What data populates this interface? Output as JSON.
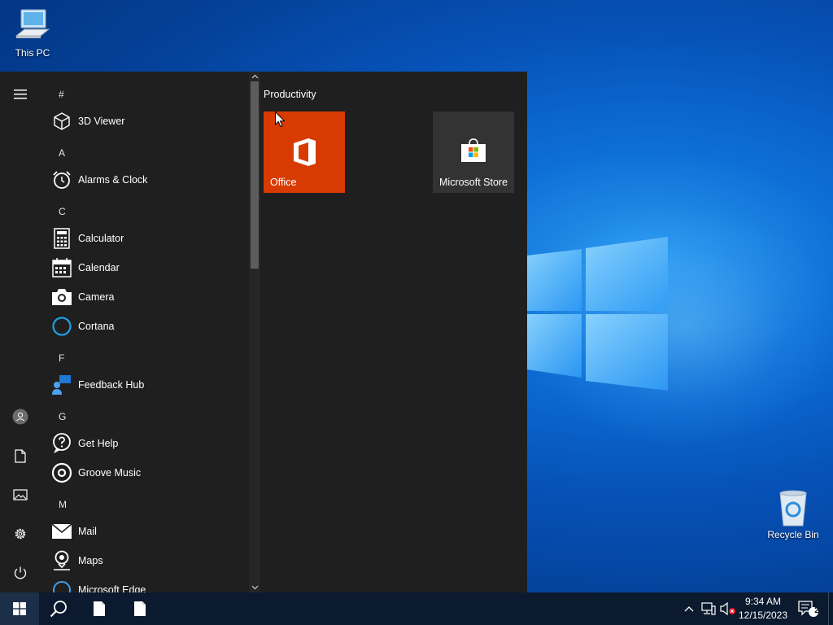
{
  "desktop": {
    "icons": [
      {
        "label": "This PC"
      },
      {
        "label": "Recycle Bin"
      }
    ]
  },
  "start_menu": {
    "app_list": {
      "sections": [
        {
          "letter": "#",
          "apps": [
            {
              "label": "3D Viewer",
              "icon": "cube-icon"
            }
          ]
        },
        {
          "letter": "A",
          "apps": [
            {
              "label": "Alarms & Clock",
              "icon": "alarm-clock-icon"
            }
          ]
        },
        {
          "letter": "C",
          "apps": [
            {
              "label": "Calculator",
              "icon": "calculator-icon"
            },
            {
              "label": "Calendar",
              "icon": "calendar-icon"
            },
            {
              "label": "Camera",
              "icon": "camera-icon"
            },
            {
              "label": "Cortana",
              "icon": "cortana-ring-icon"
            }
          ]
        },
        {
          "letter": "F",
          "apps": [
            {
              "label": "Feedback Hub",
              "icon": "feedback-person-icon"
            }
          ]
        },
        {
          "letter": "G",
          "apps": [
            {
              "label": "Get Help",
              "icon": "help-chat-icon"
            },
            {
              "label": "Groove Music",
              "icon": "groove-disc-icon"
            }
          ]
        },
        {
          "letter": "M",
          "apps": [
            {
              "label": "Mail",
              "icon": "envelope-icon"
            },
            {
              "label": "Maps",
              "icon": "map-pin-icon"
            },
            {
              "label": "Microsoft Edge",
              "icon": "edge-icon"
            }
          ]
        }
      ]
    },
    "tiles": {
      "group_title": "Productivity",
      "items": [
        {
          "label": "Office",
          "color": "#d83b01",
          "icon": "office-logo-icon"
        },
        {
          "label": "Microsoft Store",
          "color": "#333333",
          "icon": "store-bag-icon"
        }
      ]
    },
    "rail_icons": [
      "hamburger-menu-icon",
      "user-avatar-icon",
      "documents-icon",
      "pictures-icon",
      "settings-gear-icon",
      "power-icon"
    ]
  },
  "taskbar": {
    "clock": {
      "time": "9:34 AM",
      "date": "12/15/2023"
    },
    "notification_count": "2",
    "colors": {
      "background": "#0b1a2e",
      "accent": "#0078d7"
    }
  }
}
